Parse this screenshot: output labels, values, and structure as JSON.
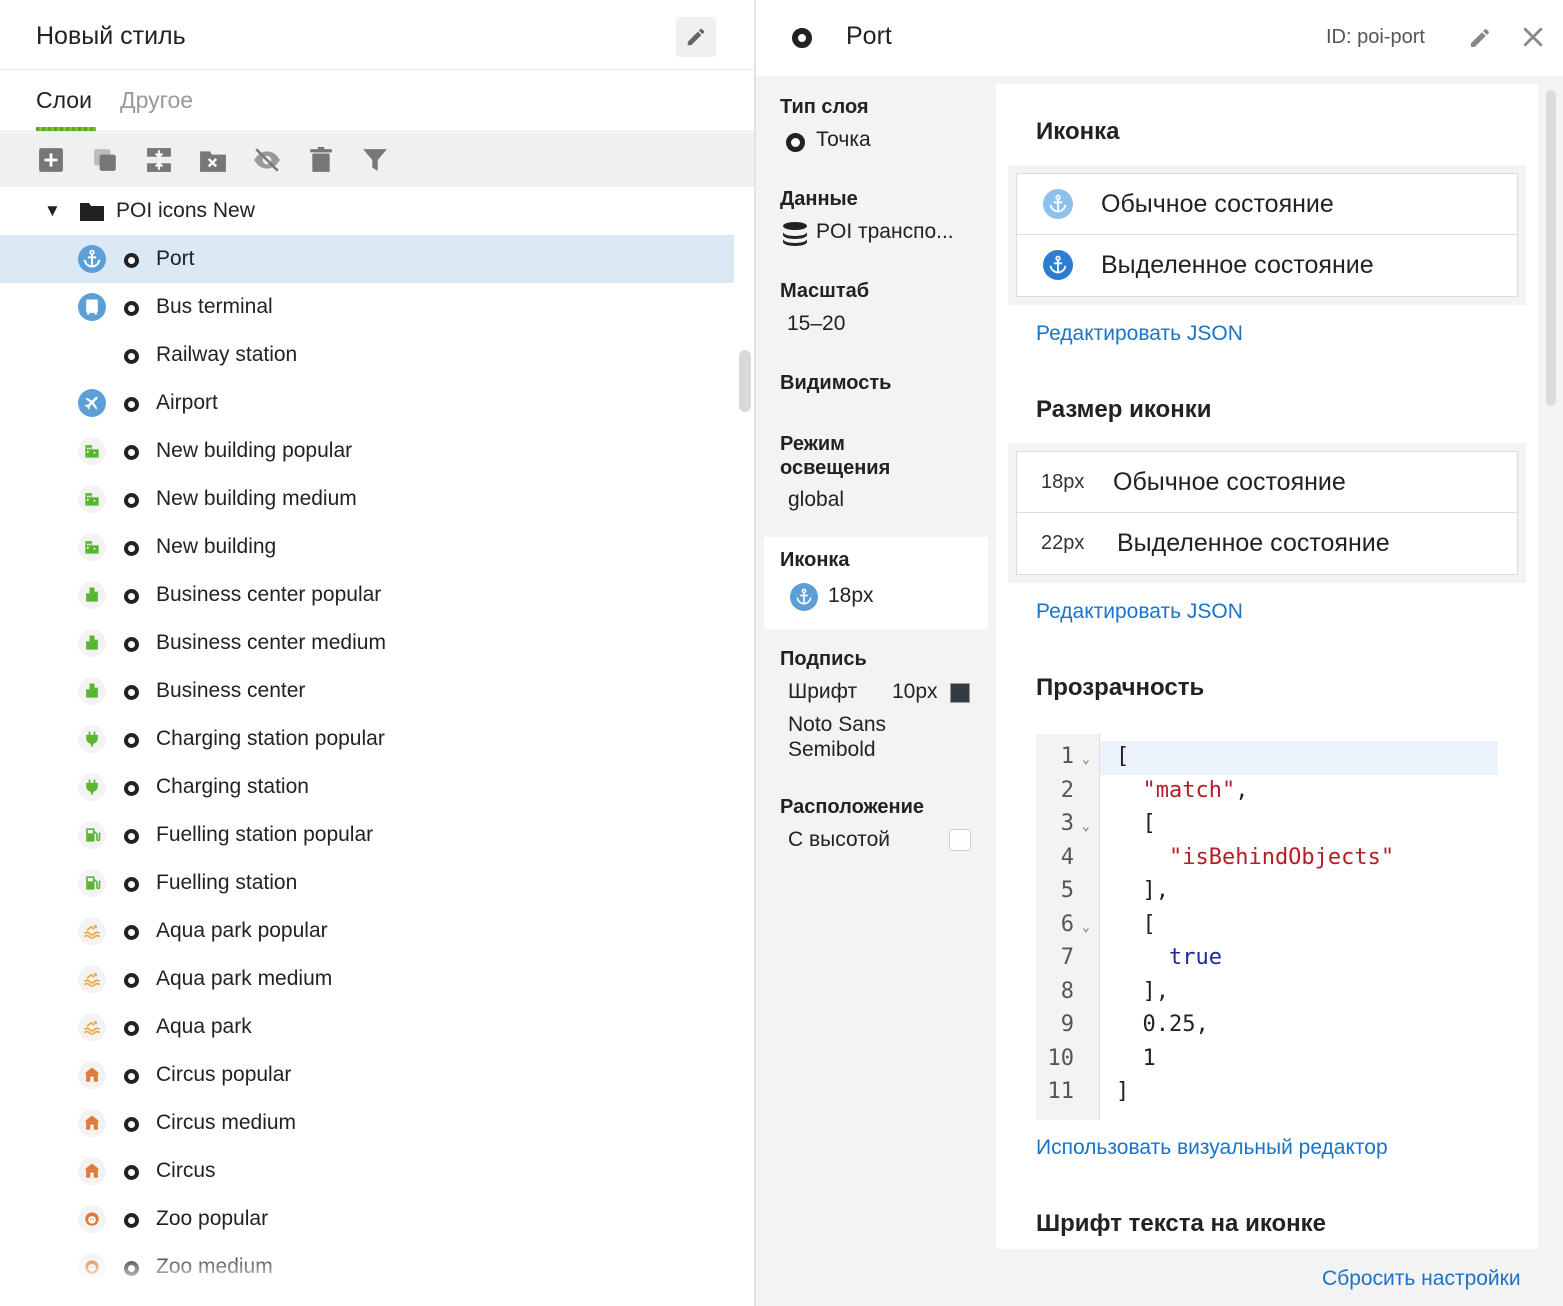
{
  "left": {
    "title": "Новый стиль",
    "tabs": [
      {
        "label": "Слои",
        "active": true
      },
      {
        "label": "Другое",
        "active": false
      }
    ],
    "toolbar": [
      "add-layer-icon",
      "duplicate-icon",
      "merge-icon",
      "delete-folder-icon",
      "hide-icon",
      "trash-icon",
      "filter-icon"
    ],
    "folder": {
      "label": "POI icons New",
      "expanded": true
    },
    "layers": [
      {
        "label": "Port",
        "icon": "anchor",
        "color": "#5b9fd6",
        "selected": true
      },
      {
        "label": "Bus terminal",
        "icon": "bus",
        "color": "#5b9fd6"
      },
      {
        "label": "Railway station",
        "icon": "none",
        "color": ""
      },
      {
        "label": "Airport",
        "icon": "plane",
        "color": "#5b9fd6"
      },
      {
        "label": "New building popular",
        "icon": "building",
        "color": "#5cb531"
      },
      {
        "label": "New building medium",
        "icon": "building",
        "color": "#5cb531"
      },
      {
        "label": "New building",
        "icon": "building",
        "color": "#5cb531"
      },
      {
        "label": "Business center popular",
        "icon": "office",
        "color": "#5cb531"
      },
      {
        "label": "Business center medium",
        "icon": "office",
        "color": "#5cb531"
      },
      {
        "label": "Business center",
        "icon": "office",
        "color": "#5cb531"
      },
      {
        "label": "Charging station popular",
        "icon": "plug",
        "color": "#5cb531"
      },
      {
        "label": "Charging station",
        "icon": "plug",
        "color": "#5cb531"
      },
      {
        "label": "Fuelling station popular",
        "icon": "fuel",
        "color": "#5cb531"
      },
      {
        "label": "Fuelling station",
        "icon": "fuel",
        "color": "#5cb531"
      },
      {
        "label": "Aqua park popular",
        "icon": "swim",
        "color": "#e8a93a"
      },
      {
        "label": "Aqua park medium",
        "icon": "swim",
        "color": "#e8a93a"
      },
      {
        "label": "Aqua park",
        "icon": "swim",
        "color": "#e8a93a"
      },
      {
        "label": "Circus popular",
        "icon": "circus",
        "color": "#e07a3a"
      },
      {
        "label": "Circus medium",
        "icon": "circus",
        "color": "#e07a3a"
      },
      {
        "label": "Circus",
        "icon": "circus",
        "color": "#e07a3a"
      },
      {
        "label": "Zoo popular",
        "icon": "lion",
        "color": "#e07a3a"
      },
      {
        "label": "Zoo medium",
        "icon": "lion",
        "color": "#e07a3a"
      }
    ]
  },
  "right": {
    "header": {
      "title": "Port",
      "id": "ID: poi-port"
    },
    "props": {
      "layer_type": {
        "title": "Тип слоя",
        "value": "Точка"
      },
      "data": {
        "title": "Данные",
        "value": "POI транспо..."
      },
      "scale": {
        "title": "Масштаб",
        "value": "15–20"
      },
      "visibility": {
        "title": "Видимость"
      },
      "lighting": {
        "title": "Режим освещения",
        "value": "global"
      },
      "icon": {
        "title": "Иконка",
        "value": "18px"
      },
      "caption": {
        "title": "Подпись",
        "font_label": "Шрифт",
        "font_size": "10px",
        "font_name": "Noto Sans Semibold",
        "swatch": "#333a44"
      },
      "placement": {
        "title": "Расположение",
        "value": "С высотой",
        "checked": false
      }
    },
    "icon_section": {
      "title": "Иконка",
      "states": [
        "Обычное состояние",
        "Выделенное состояние"
      ],
      "edit_json": "Редактировать JSON"
    },
    "size_section": {
      "title": "Размер иконки",
      "states": [
        {
          "size": "18px",
          "label": "Обычное состояние"
        },
        {
          "size": "22px",
          "label": "Выделенное состояние"
        }
      ],
      "edit_json": "Редактировать JSON"
    },
    "opacity_section": {
      "title": "Прозрачность",
      "code_lines": [
        {
          "n": "1",
          "fold": true,
          "text": "[",
          "kind": "plain"
        },
        {
          "n": "2",
          "fold": false,
          "text": "  \"match\",",
          "kind": "match"
        },
        {
          "n": "3",
          "fold": true,
          "text": "  [",
          "kind": "plain"
        },
        {
          "n": "4",
          "fold": false,
          "text": "    \"isBehindObjects\"",
          "kind": "string"
        },
        {
          "n": "5",
          "fold": false,
          "text": "  ],",
          "kind": "plain"
        },
        {
          "n": "6",
          "fold": true,
          "text": "  [",
          "kind": "plain"
        },
        {
          "n": "7",
          "fold": false,
          "text": "    true",
          "kind": "keyword"
        },
        {
          "n": "8",
          "fold": false,
          "text": "  ],",
          "kind": "plain"
        },
        {
          "n": "9",
          "fold": false,
          "text": "  0.25,",
          "kind": "plain"
        },
        {
          "n": "10",
          "fold": false,
          "text": "  1",
          "kind": "plain"
        },
        {
          "n": "11",
          "fold": false,
          "text": "]",
          "kind": "plain"
        }
      ],
      "visual_editor": "Использовать визуальный редактор"
    },
    "font_section": {
      "title": "Шрифт текста на иконке"
    },
    "reset": "Сбросить настройки"
  }
}
